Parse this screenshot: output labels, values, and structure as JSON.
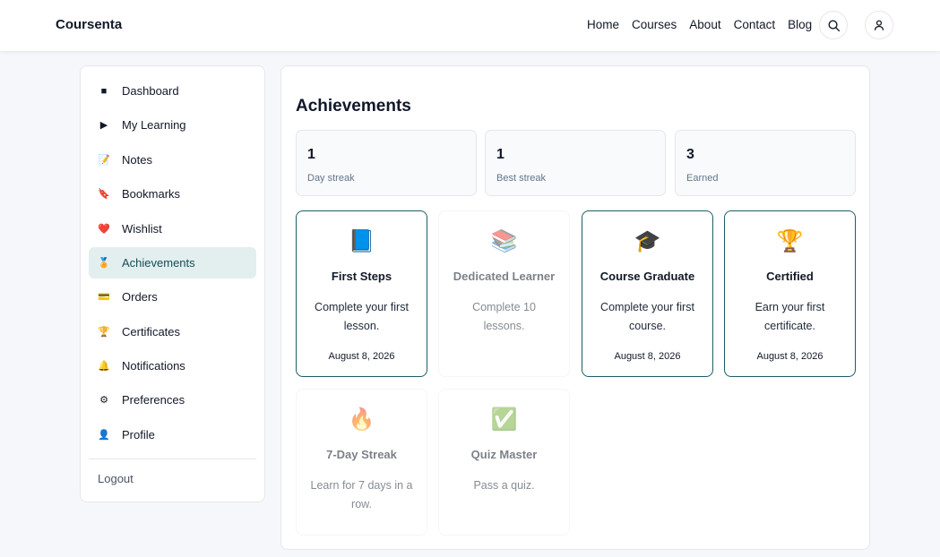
{
  "brand": "Coursenta",
  "nav": [
    "Home",
    "Courses",
    "About",
    "Contact",
    "Blog"
  ],
  "sidebar": {
    "items": [
      {
        "label": "Dashboard",
        "icon": "■"
      },
      {
        "label": "My Learning",
        "icon": "▶"
      },
      {
        "label": "Notes",
        "icon": "📝"
      },
      {
        "label": "Bookmarks",
        "icon": "🔖"
      },
      {
        "label": "Wishlist",
        "icon": "❤️"
      },
      {
        "label": "Achievements",
        "icon": "🏅"
      },
      {
        "label": "Orders",
        "icon": "💳"
      },
      {
        "label": "Certificates",
        "icon": "🏆"
      },
      {
        "label": "Notifications",
        "icon": "🔔"
      },
      {
        "label": "Preferences",
        "icon": "⚙"
      },
      {
        "label": "Profile",
        "icon": "👤"
      }
    ],
    "active": "Achievements",
    "logout": "Logout"
  },
  "main": {
    "title": "Achievements",
    "stats": [
      {
        "value": "1",
        "label": "Day streak"
      },
      {
        "value": "1",
        "label": "Best streak"
      },
      {
        "value": "3",
        "label": "Earned"
      }
    ],
    "badges": [
      {
        "icon": "📘",
        "title": "First Steps",
        "desc": "Complete your first lesson.",
        "date": "August 8, 2026",
        "earned": true
      },
      {
        "icon": "📚",
        "title": "Dedicated Learner",
        "desc": "Complete 10 lessons.",
        "date": "",
        "earned": false
      },
      {
        "icon": "🎓",
        "title": "Course Graduate",
        "desc": "Complete your first course.",
        "date": "August 8, 2026",
        "earned": true
      },
      {
        "icon": "🏆",
        "title": "Certified",
        "desc": "Earn your first certificate.",
        "date": "August 8, 2026",
        "earned": true
      },
      {
        "icon": "🔥",
        "title": "7-Day Streak",
        "desc": "Learn for 7 days in a row.",
        "date": "",
        "earned": false
      },
      {
        "icon": "✅",
        "title": "Quiz Master",
        "desc": "Pass a quiz.",
        "date": "",
        "earned": false
      }
    ]
  },
  "colors": {
    "accent": "#1d5e66",
    "active_bg": "#e3efef",
    "page_bg": "#f5f7fa"
  }
}
